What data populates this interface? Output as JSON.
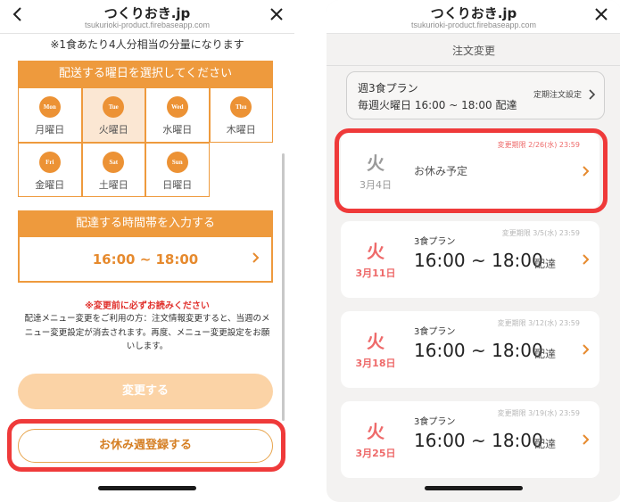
{
  "left": {
    "header": {
      "title": "つくりおき.jp",
      "url": "tsukurioki-product.firebaseapp.com"
    },
    "note_top": "※1食あたり4人分相当の分量になります",
    "day_section": {
      "title": "配送する曜日を選択してください",
      "days": [
        {
          "abbr": "Mon",
          "label": "月曜日",
          "selected": false
        },
        {
          "abbr": "Tue",
          "label": "火曜日",
          "selected": true
        },
        {
          "abbr": "Wed",
          "label": "水曜日",
          "selected": false
        },
        {
          "abbr": "Thu",
          "label": "木曜日",
          "selected": false
        },
        {
          "abbr": "Fri",
          "label": "金曜日",
          "selected": false
        },
        {
          "abbr": "Sat",
          "label": "土曜日",
          "selected": false
        },
        {
          "abbr": "Sun",
          "label": "日曜日",
          "selected": false
        }
      ]
    },
    "time_section": {
      "title": "配達する時間帯を入力する",
      "value": "16:00 ~ 18:00"
    },
    "warning": {
      "title": "※変更前に必ずお読みください",
      "line1": "配達メニュー変更をご利用の方：注文情報変更すると、当週のメ",
      "line2": "ニュー変更設定が消去されます。再度、メニュー変更設定をお願",
      "line3": "いします。"
    },
    "buttons": {
      "change": "変更する",
      "rest": "お休み週登録する"
    }
  },
  "right": {
    "header": {
      "title": "つくりおき.jp",
      "url": "tsukurioki-product.firebaseapp.com"
    },
    "subheader": "注文変更",
    "plan": {
      "name": "週3食プラン",
      "schedule": "毎週火曜日 16:00 ~ 18:00 配達",
      "setting": "定期注文設定"
    },
    "orders": [
      {
        "day": "火",
        "date": "3月4日",
        "deadline": "変更期限 2/26(水) 23:59",
        "status": "お休み予定",
        "rest": true
      },
      {
        "day": "火",
        "date": "3月11日",
        "deadline": "変更期限 3/5(水) 23:59",
        "plan": "3食プラン",
        "time": "16:00 ~ 18:00",
        "suffix": "配達",
        "rest": false
      },
      {
        "day": "火",
        "date": "3月18日",
        "deadline": "変更期限 3/12(水) 23:59",
        "plan": "3食プラン",
        "time": "16:00 ~ 18:00",
        "suffix": "配達",
        "rest": false
      },
      {
        "day": "火",
        "date": "3月25日",
        "deadline": "変更期限 3/19(水) 23:59",
        "plan": "3食プラン",
        "time": "16:00 ~ 18:00",
        "suffix": "配達",
        "rest": false
      }
    ]
  },
  "colors": {
    "accent": "#ee9a3d",
    "highlight": "#ef3a3a",
    "rest_gray": "#9a9a9a",
    "day_red": "#ee6a6a"
  }
}
